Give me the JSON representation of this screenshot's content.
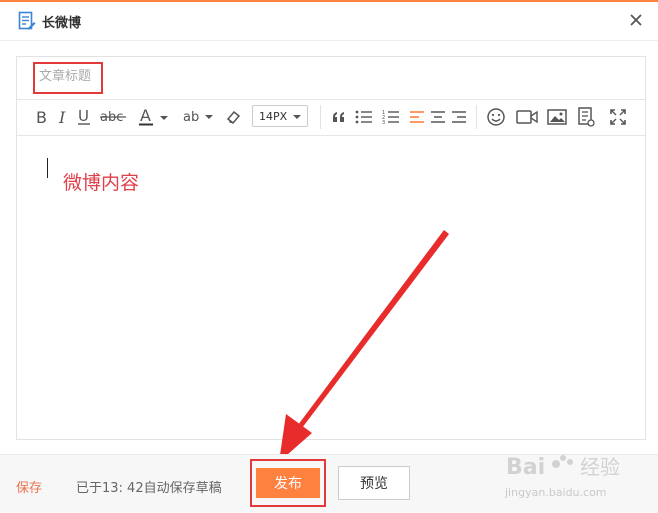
{
  "window": {
    "title": "长微博",
    "icon": "document-edit-icon",
    "accent_color": "#ff8140"
  },
  "editor": {
    "title_placeholder": "文章标题",
    "body_text": "微博内容",
    "toolbar": {
      "items": [
        "bold",
        "italic",
        "underline",
        "strikethrough",
        "font-color",
        "highlight",
        "eraser",
        "font-size",
        "quote",
        "unordered-list",
        "ordered-list",
        "align-left",
        "align-center",
        "align-right",
        "emoji",
        "video",
        "image",
        "article",
        "fullscreen"
      ],
      "font_size": "14PX"
    }
  },
  "footer": {
    "save_label": "保存",
    "autosave_status": "已于13: 42自动保存草稿",
    "publish_label": "发布",
    "preview_label": "预览"
  },
  "watermark": {
    "brand": "Baidu 经验",
    "url": "jingyan.baidu.com"
  }
}
